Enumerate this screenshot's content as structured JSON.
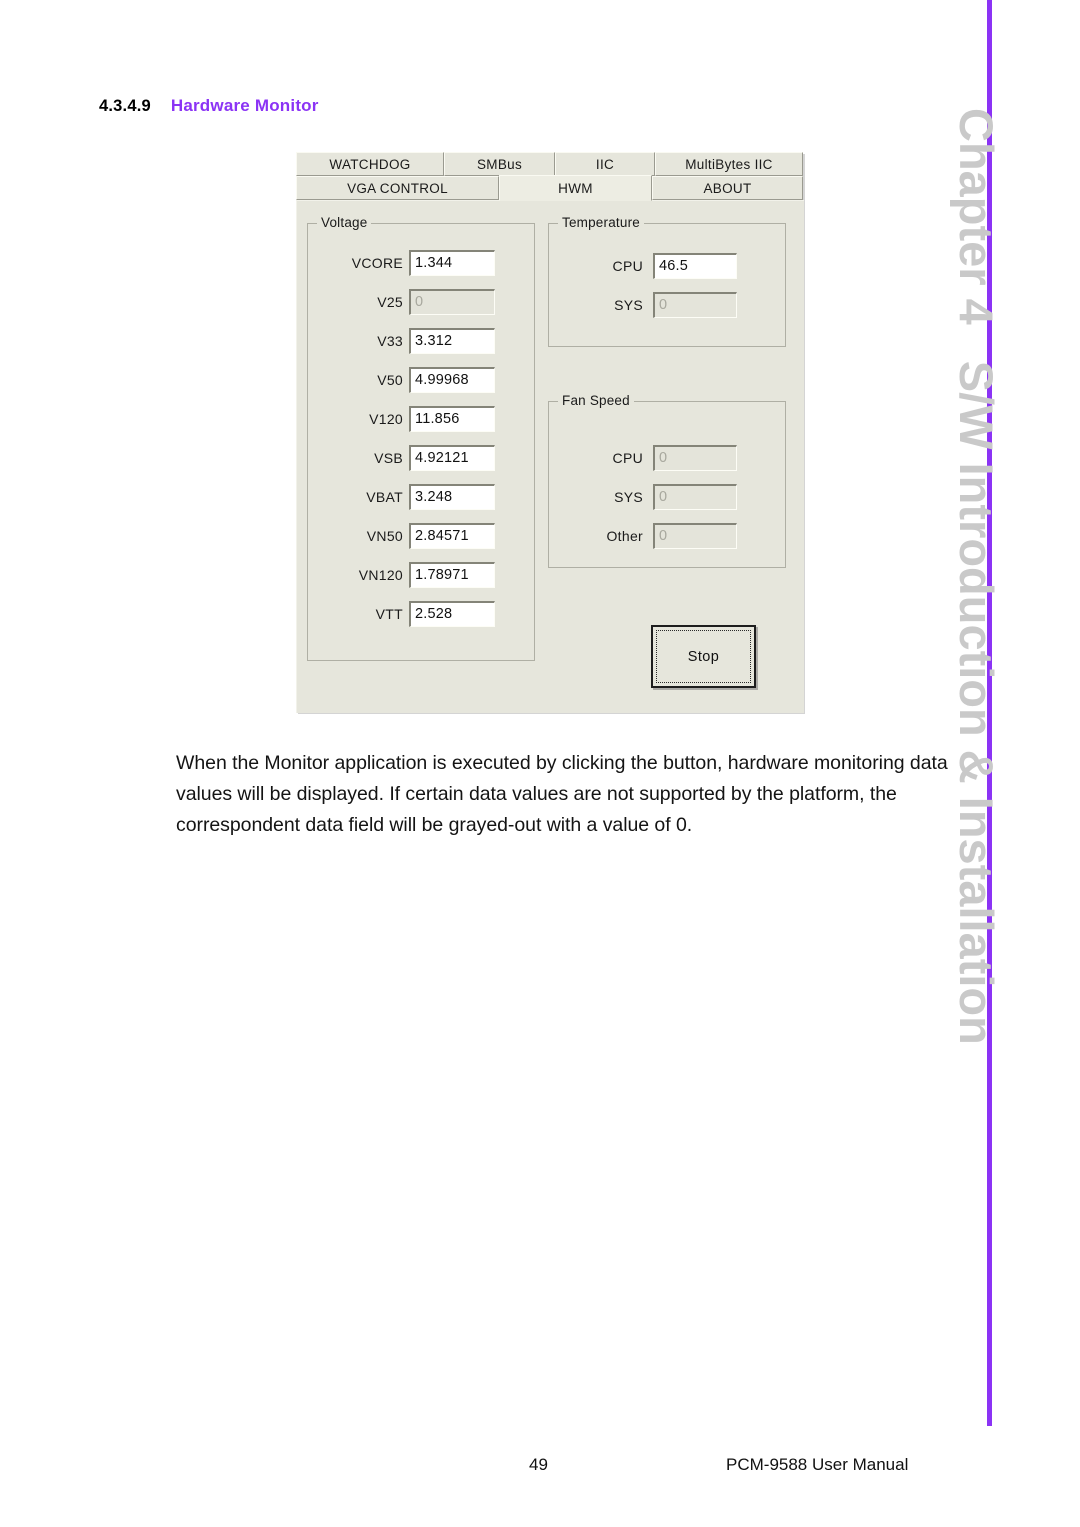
{
  "page": {
    "section_number": "4.3.4.9",
    "section_title": "Hardware Monitor",
    "side_chapter": "Chapter 4",
    "side_subtitle": "S/W Introduction & Installation",
    "body_paragraph": "When the Monitor application is executed by clicking the button, hardware monitoring data values will be displayed. If certain data values are not supported by the platform, the correspondent data field will be grayed-out with a value of 0.",
    "page_number": "49",
    "footer_right": "PCM-9588 User Manual",
    "accent_color": "#8B33F5"
  },
  "dialog": {
    "tabs_row1": [
      {
        "label": "WATCHDOG",
        "selected": false
      },
      {
        "label": "SMBus",
        "selected": false
      },
      {
        "label": "IIC",
        "selected": false
      },
      {
        "label": "MultiBytes IIC",
        "selected": false
      }
    ],
    "tabs_row2": [
      {
        "label": "VGA CONTROL",
        "selected": false
      },
      {
        "label": "HWM",
        "selected": true
      },
      {
        "label": "ABOUT",
        "selected": false
      }
    ],
    "voltage": {
      "caption": "Voltage",
      "fields": [
        {
          "label": "VCORE",
          "value": "1.344",
          "disabled": false
        },
        {
          "label": "V25",
          "value": "0",
          "disabled": true
        },
        {
          "label": "V33",
          "value": "3.312",
          "disabled": false
        },
        {
          "label": "V50",
          "value": "4.99968",
          "disabled": false
        },
        {
          "label": "V120",
          "value": "11.856",
          "disabled": false
        },
        {
          "label": "VSB",
          "value": "4.92121",
          "disabled": false
        },
        {
          "label": "VBAT",
          "value": "3.248",
          "disabled": false
        },
        {
          "label": "VN50",
          "value": "2.84571",
          "disabled": false
        },
        {
          "label": "VN120",
          "value": "1.78971",
          "disabled": false
        },
        {
          "label": "VTT",
          "value": "2.528",
          "disabled": false
        }
      ]
    },
    "temperature": {
      "caption": "Temperature",
      "fields": [
        {
          "label": "CPU",
          "value": "46.5",
          "disabled": false
        },
        {
          "label": "SYS",
          "value": "0",
          "disabled": true
        }
      ]
    },
    "fan_speed": {
      "caption": "Fan Speed",
      "fields": [
        {
          "label": "CPU",
          "value": "0",
          "disabled": true
        },
        {
          "label": "SYS",
          "value": "0",
          "disabled": true
        },
        {
          "label": "Other",
          "value": "0",
          "disabled": true
        }
      ]
    },
    "stop_button": {
      "label": "Stop"
    }
  }
}
